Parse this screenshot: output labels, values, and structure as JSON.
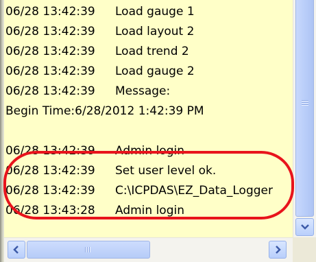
{
  "log": {
    "lines": [
      {
        "time": "06/28 13:42:39",
        "text": "Load gauge 1"
      },
      {
        "time": "06/28 13:42:39",
        "text": "Load layout 2"
      },
      {
        "time": "06/28 13:42:39",
        "text": "Load trend 2"
      },
      {
        "time": "06/28 13:42:39",
        "text": "Load gauge 2"
      },
      {
        "time": "06/28 13:42:39",
        "text": "Message:"
      },
      {
        "time": "",
        "text": "Begin Time:6/28/2012 1:42:39 PM"
      },
      {
        "time": "",
        "text": ""
      },
      {
        "time": "06/28 13:42:39",
        "text": "Admin login"
      },
      {
        "time": "06/28 13:42:39",
        "text": "Set user level ok."
      },
      {
        "time": "06/28 13:42:39",
        "text": "C:\\ICPDAS\\EZ_Data_Logger"
      },
      {
        "time": "06/28 13:43:28",
        "text": "Admin login"
      }
    ]
  },
  "icons": {
    "scroll_down": "chevron-down-icon",
    "scroll_left": "chevron-left-icon",
    "scroll_right": "chevron-right-icon"
  },
  "colors": {
    "log_background": "#ffffc8",
    "scrollbar_accent": "#b9cffb",
    "highlight_annotation": "#e8141c"
  }
}
